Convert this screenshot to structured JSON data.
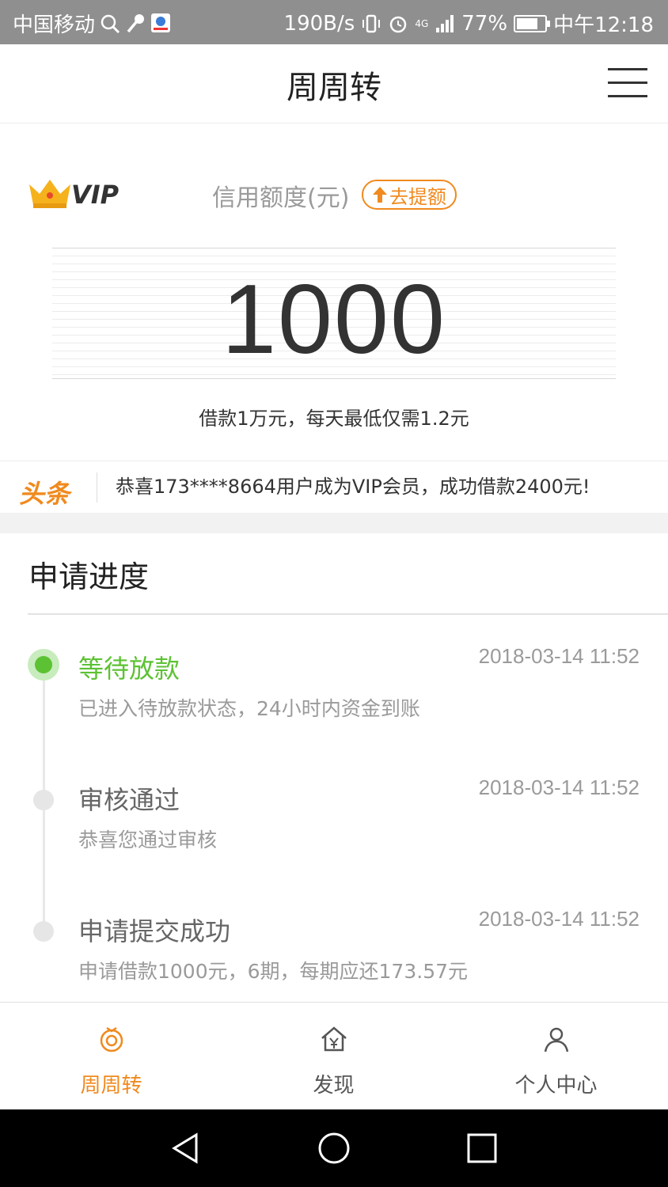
{
  "status_bar": {
    "carrier": "中国移动",
    "speed": "190B/s",
    "network": "4G",
    "battery": "77%",
    "battery_level": 0.77,
    "time": "中午12:18"
  },
  "header": {
    "title": "周周转"
  },
  "credit": {
    "vip_badge": "VIP",
    "label": "信用额度(元)",
    "raise_button": "去提额",
    "amount": "1000",
    "note": "借款1万元，每天最低仅需1.2元"
  },
  "ticker": {
    "logo": "头条",
    "message": "恭喜173****8664用户成为VIP会员，成功借款2400元!"
  },
  "progress": {
    "title": "申请进度",
    "steps": [
      {
        "title": "等待放款",
        "time": "2018-03-14 11:52",
        "desc": "已进入待放款状态，24小时内资金到账",
        "active": true
      },
      {
        "title": "审核通过",
        "time": "2018-03-14 11:52",
        "desc": "恭喜您通过审核",
        "active": false
      },
      {
        "title": "申请提交成功",
        "time": "2018-03-14 11:52",
        "desc": "申请借款1000元，6期，每期应还173.57元",
        "active": false
      }
    ]
  },
  "tabbar": {
    "items": [
      {
        "label": "周周转",
        "icon": "zhouzhouzhuan-icon",
        "active": true
      },
      {
        "label": "发现",
        "icon": "discover-house-yen-icon",
        "active": false
      },
      {
        "label": "个人中心",
        "icon": "user-icon",
        "active": false
      }
    ]
  },
  "colors": {
    "accent": "#f08a1e",
    "success": "#5cc233",
    "status_bar_bg": "#8f8f8f"
  }
}
